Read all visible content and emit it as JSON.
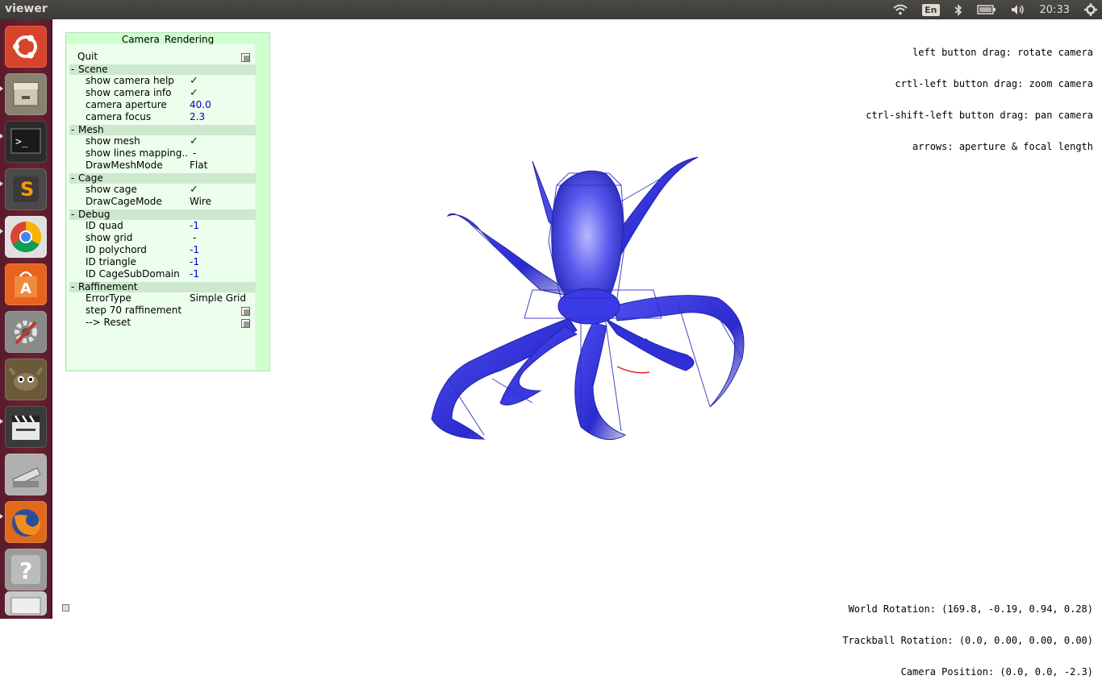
{
  "topbar": {
    "app_title": "viewer",
    "keyboard_layout": "En",
    "clock": "20:33",
    "icons": [
      "wifi-icon",
      "keyboard-icon",
      "bluetooth-icon",
      "battery-icon",
      "volume-icon",
      "settings-gear-icon"
    ]
  },
  "launcher": {
    "items": [
      {
        "name": "ubuntu-dash-icon",
        "color": "#d8442a"
      },
      {
        "name": "files-icon",
        "color": "#8a8270"
      },
      {
        "name": "terminal-icon",
        "color": "#2c2c2c"
      },
      {
        "name": "sublime-text-icon",
        "color": "#4a4a4a"
      },
      {
        "name": "chrome-icon",
        "color": "#e0e0e0"
      },
      {
        "name": "software-center-icon",
        "color": "#e8641c"
      },
      {
        "name": "system-settings-icon",
        "color": "#8a8a8a"
      },
      {
        "name": "gimp-icon",
        "color": "#6a5a3a"
      },
      {
        "name": "video-editor-icon",
        "color": "#3a3a3a"
      },
      {
        "name": "scanner-icon",
        "color": "#b0b0b0"
      },
      {
        "name": "firefox-icon",
        "color": "#e06a1c"
      },
      {
        "name": "help-icon",
        "color": "#9a9a9a"
      },
      {
        "name": "workspace-icon",
        "color": "#c8c8c8"
      }
    ]
  },
  "panel": {
    "title": "Camera_Rendering",
    "quit": "Quit",
    "sections": {
      "scene": "Scene",
      "mesh": "Mesh",
      "cage": "Cage",
      "debug": "Debug",
      "raffinement": "Raffinement"
    },
    "scene": {
      "show_camera_help": {
        "label": "show camera help",
        "checked": true
      },
      "show_camera_info": {
        "label": "show camera info",
        "checked": true
      },
      "camera_aperture": {
        "label": "camera aperture",
        "value": "40.0"
      },
      "camera_focus": {
        "label": "camera focus",
        "value": "2.3"
      }
    },
    "mesh": {
      "show_mesh": {
        "label": "show mesh",
        "checked": true
      },
      "show_lines_mapping": {
        "label": "show lines mapping..",
        "value": "-"
      },
      "draw_mesh_mode": {
        "label": "DrawMeshMode",
        "value": "Flat"
      }
    },
    "cage": {
      "show_cage": {
        "label": "show cage",
        "checked": true
      },
      "draw_cage_mode": {
        "label": "DrawCageMode",
        "value": "Wire"
      }
    },
    "debug": {
      "id_quad": {
        "label": "ID quad",
        "value": "-1"
      },
      "show_grid": {
        "label": "show grid",
        "value": "-"
      },
      "id_polychord": {
        "label": "ID polychord",
        "value": "-1"
      },
      "id_triangle": {
        "label": "ID triangle",
        "value": "-1"
      },
      "id_cage_subdomain": {
        "label": "ID CageSubDomain",
        "value": "-1"
      }
    },
    "raffinement": {
      "error_type": {
        "label": "ErrorType",
        "value": "Simple Grid"
      },
      "step": {
        "label": "step 70 raffinement"
      },
      "reset": {
        "label": "--> Reset"
      }
    },
    "check_glyph": "✓"
  },
  "help": {
    "lines": [
      "left button drag: rotate camera",
      "crtl-left button drag: zoom camera",
      "ctrl-shift-left button drag: pan camera",
      "arrows: aperture & focal length"
    ]
  },
  "info": {
    "world_rotation": "World Rotation: (169.8, -0.19, 0.94, 0.28)",
    "trackball_rotation": "Trackball Rotation: (0.0, 0.00, 0.00, 0.00)",
    "camera_position": "Camera Position: (0.0, 0.0, -2.3)"
  },
  "scene_colors": {
    "mesh": "#3a3ae6",
    "cage": "#2222aa",
    "highlight": "#ffffff"
  }
}
